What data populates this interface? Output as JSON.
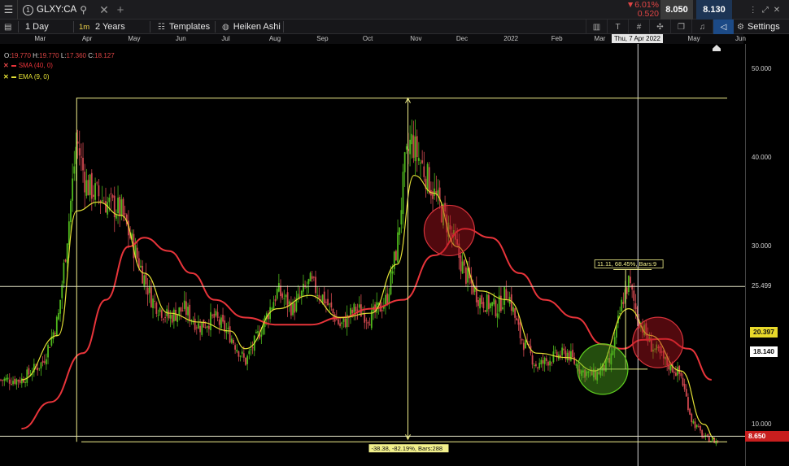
{
  "header": {
    "symbol": "GLXY:CA",
    "change_pct": "▼6.01%",
    "change_abs": "0.520",
    "bid": "8.050",
    "ask": "8.130"
  },
  "toolbar": {
    "interval_label": "1 Day",
    "interval_short": "1m",
    "range_label": "2 Years",
    "templates_label": "Templates",
    "chart_type_label": "Heiken Ashi",
    "settings_label": "Settings"
  },
  "ohlc": {
    "o_label": "O:",
    "o_value": "19.770",
    "h_label": "H:",
    "h_value": "19.770",
    "l_label": "L:",
    "l_value": "17.360",
    "c_label": "C:",
    "c_value": "18.127"
  },
  "indicators": [
    {
      "label": "SMA (40, 0)",
      "color": "#e8343a"
    },
    {
      "label": "EMA (9, 0)",
      "color": "#e4e035"
    }
  ],
  "crosshair_date": "Thu, 7 Apr 2022",
  "colors": {
    "up_candle": "#4fb81c",
    "down_candle": "#d0484f",
    "sma": "#e8343a",
    "ema": "#e4e035",
    "annotation": "#f2f08c",
    "circle_red_fill": "rgba(180,20,30,0.45)",
    "circle_green_fill": "rgba(80,170,30,0.45)",
    "last_price_tag": "#c81e1e",
    "ema_tag": "#e8d92a"
  },
  "chart_data": {
    "type": "candlestick",
    "title": "GLXY:CA",
    "x_axis_labels": [
      "Mar",
      "Apr",
      "May",
      "Jun",
      "Jul",
      "Aug",
      "Sep",
      "Oct",
      "Nov",
      "Dec",
      "2022",
      "Feb",
      "Mar",
      "Apr",
      "May",
      "Jun"
    ],
    "y_axis_ticks": [
      10.0,
      20.0,
      30.0,
      40.0,
      50.0
    ],
    "y_axis_tick_labels": [
      "10.000",
      "20.000",
      "30.000",
      "40.000",
      "50.000"
    ],
    "ylim": [
      5.3,
      52.8
    ],
    "scale": "linear",
    "grid": false,
    "legend": "top-left",
    "price_trend": [
      {
        "date": "2021-03-01",
        "value": 15.0
      },
      {
        "date": "2021-03-15",
        "value": 17.0
      },
      {
        "date": "2021-03-25",
        "value": 22.0
      },
      {
        "date": "2021-04-01",
        "value": 33.0
      },
      {
        "date": "2021-04-06",
        "value": 42.0
      },
      {
        "date": "2021-04-12",
        "value": 37.0
      },
      {
        "date": "2021-04-25",
        "value": 35.0
      },
      {
        "date": "2021-05-05",
        "value": 34.0
      },
      {
        "date": "2021-05-15",
        "value": 29.0
      },
      {
        "date": "2021-05-25",
        "value": 24.0
      },
      {
        "date": "2021-06-05",
        "value": 22.0
      },
      {
        "date": "2021-06-15",
        "value": 23.0
      },
      {
        "date": "2021-06-25",
        "value": 21.0
      },
      {
        "date": "2021-07-05",
        "value": 22.0
      },
      {
        "date": "2021-07-15",
        "value": 20.0
      },
      {
        "date": "2021-07-25",
        "value": 17.0
      },
      {
        "date": "2021-08-05",
        "value": 21.0
      },
      {
        "date": "2021-08-15",
        "value": 25.0
      },
      {
        "date": "2021-08-25",
        "value": 23.0
      },
      {
        "date": "2021-09-05",
        "value": 26.0
      },
      {
        "date": "2021-09-15",
        "value": 24.0
      },
      {
        "date": "2021-09-25",
        "value": 21.0
      },
      {
        "date": "2021-10-05",
        "value": 23.0
      },
      {
        "date": "2021-10-15",
        "value": 22.0
      },
      {
        "date": "2021-10-25",
        "value": 24.0
      },
      {
        "date": "2021-11-01",
        "value": 30.0
      },
      {
        "date": "2021-11-06",
        "value": 39.0
      },
      {
        "date": "2021-11-10",
        "value": 42.0
      },
      {
        "date": "2021-11-15",
        "value": 40.0
      },
      {
        "date": "2021-11-25",
        "value": 36.0
      },
      {
        "date": "2021-12-05",
        "value": 32.0
      },
      {
        "date": "2021-12-15",
        "value": 27.0
      },
      {
        "date": "2021-12-25",
        "value": 24.0
      },
      {
        "date": "2022-01-05",
        "value": 23.0
      },
      {
        "date": "2022-01-12",
        "value": 25.0
      },
      {
        "date": "2022-01-20",
        "value": 20.0
      },
      {
        "date": "2022-01-31",
        "value": 16.5
      },
      {
        "date": "2022-02-10",
        "value": 17.5
      },
      {
        "date": "2022-02-20",
        "value": 18.0
      },
      {
        "date": "2022-03-01",
        "value": 16.0
      },
      {
        "date": "2022-03-10",
        "value": 15.5
      },
      {
        "date": "2022-03-20",
        "value": 17.0
      },
      {
        "date": "2022-03-28",
        "value": 24.0
      },
      {
        "date": "2022-04-01",
        "value": 26.0
      },
      {
        "date": "2022-04-07",
        "value": 22.0
      },
      {
        "date": "2022-04-15",
        "value": 19.0
      },
      {
        "date": "2022-04-25",
        "value": 17.0
      },
      {
        "date": "2022-05-05",
        "value": 15.5
      },
      {
        "date": "2022-05-12",
        "value": 10.5
      },
      {
        "date": "2022-05-20",
        "value": 8.5
      },
      {
        "date": "2022-05-27",
        "value": 8.1
      }
    ],
    "series": [
      {
        "name": "SMA (40, 0)",
        "values": [
          {
            "date": "2021-03-01",
            "value": 9.5
          },
          {
            "date": "2021-03-20",
            "value": 12.5
          },
          {
            "date": "2021-04-10",
            "value": 18.0
          },
          {
            "date": "2021-04-25",
            "value": 24.0
          },
          {
            "date": "2021-05-10",
            "value": 30.0
          },
          {
            "date": "2021-05-20",
            "value": 31.0
          },
          {
            "date": "2021-06-05",
            "value": 29.5
          },
          {
            "date": "2021-06-20",
            "value": 27.0
          },
          {
            "date": "2021-07-05",
            "value": 24.0
          },
          {
            "date": "2021-07-25",
            "value": 22.0
          },
          {
            "date": "2021-08-15",
            "value": 21.2
          },
          {
            "date": "2021-09-05",
            "value": 21.2
          },
          {
            "date": "2021-09-25",
            "value": 22.0
          },
          {
            "date": "2021-10-15",
            "value": 23.0
          },
          {
            "date": "2021-11-05",
            "value": 24.0
          },
          {
            "date": "2021-11-25",
            "value": 29.0
          },
          {
            "date": "2021-12-15",
            "value": 32.0
          },
          {
            "date": "2022-01-01",
            "value": 31.0
          },
          {
            "date": "2022-01-20",
            "value": 27.0
          },
          {
            "date": "2022-02-05",
            "value": 24.0
          },
          {
            "date": "2022-02-25",
            "value": 22.0
          },
          {
            "date": "2022-03-15",
            "value": 19.0
          },
          {
            "date": "2022-03-28",
            "value": 18.5
          },
          {
            "date": "2022-04-10",
            "value": 19.5
          },
          {
            "date": "2022-04-25",
            "value": 19.6
          },
          {
            "date": "2022-05-10",
            "value": 18.5
          },
          {
            "date": "2022-05-25",
            "value": 15.0
          }
        ]
      },
      {
        "name": "EMA (9, 0)",
        "values": [
          {
            "date": "2021-03-01",
            "value": 15.0
          },
          {
            "date": "2021-03-25",
            "value": 20.0
          },
          {
            "date": "2021-04-06",
            "value": 34.0
          },
          {
            "date": "2021-04-20",
            "value": 35.0
          },
          {
            "date": "2021-05-05",
            "value": 33.5
          },
          {
            "date": "2021-05-20",
            "value": 27.0
          },
          {
            "date": "2021-06-05",
            "value": 22.5
          },
          {
            "date": "2021-06-25",
            "value": 21.5
          },
          {
            "date": "2021-07-15",
            "value": 20.5
          },
          {
            "date": "2021-07-25",
            "value": 18.5
          },
          {
            "date": "2021-08-15",
            "value": 23.0
          },
          {
            "date": "2021-09-05",
            "value": 24.5
          },
          {
            "date": "2021-09-25",
            "value": 22.0
          },
          {
            "date": "2021-10-15",
            "value": 22.5
          },
          {
            "date": "2021-11-01",
            "value": 28.0
          },
          {
            "date": "2021-11-12",
            "value": 38.0
          },
          {
            "date": "2021-11-25",
            "value": 36.0
          },
          {
            "date": "2021-12-10",
            "value": 30.0
          },
          {
            "date": "2021-12-25",
            "value": 25.0
          },
          {
            "date": "2022-01-12",
            "value": 24.0
          },
          {
            "date": "2022-01-31",
            "value": 18.0
          },
          {
            "date": "2022-02-20",
            "value": 17.5
          },
          {
            "date": "2022-03-10",
            "value": 16.0
          },
          {
            "date": "2022-04-01",
            "value": 23.0
          },
          {
            "date": "2022-04-15",
            "value": 20.0
          },
          {
            "date": "2022-05-05",
            "value": 16.0
          },
          {
            "date": "2022-05-20",
            "value": 10.0
          },
          {
            "date": "2022-05-27",
            "value": 8.4
          }
        ]
      }
    ],
    "horizontal_lines": [
      {
        "value": 25.499,
        "label": "25.499"
      },
      {
        "value": 8.65,
        "label": "8.650"
      }
    ],
    "price_tags": [
      {
        "value": 20.397,
        "label": "20.397",
        "kind": "EMA (9, 0)"
      },
      {
        "value": 18.14,
        "label": "18.140",
        "kind": "SMA (40, 0)"
      },
      {
        "value": 8.65,
        "label": "8.650",
        "kind": "last"
      }
    ],
    "annotations": [
      {
        "text": "-38.38, -82.19%, Bars:288",
        "from_value": 46.7,
        "to_value": 8.3
      },
      {
        "text": "11.11, 68.45%, Bars:9",
        "from_value": 16.2,
        "to_value": 27.4
      }
    ],
    "circles": [
      {
        "date": "2021-12-05",
        "value": 31.8,
        "color": "red"
      },
      {
        "date": "2022-03-15",
        "value": 16.2,
        "color": "green"
      },
      {
        "date": "2022-04-20",
        "value": 19.2,
        "color": "red"
      }
    ]
  }
}
